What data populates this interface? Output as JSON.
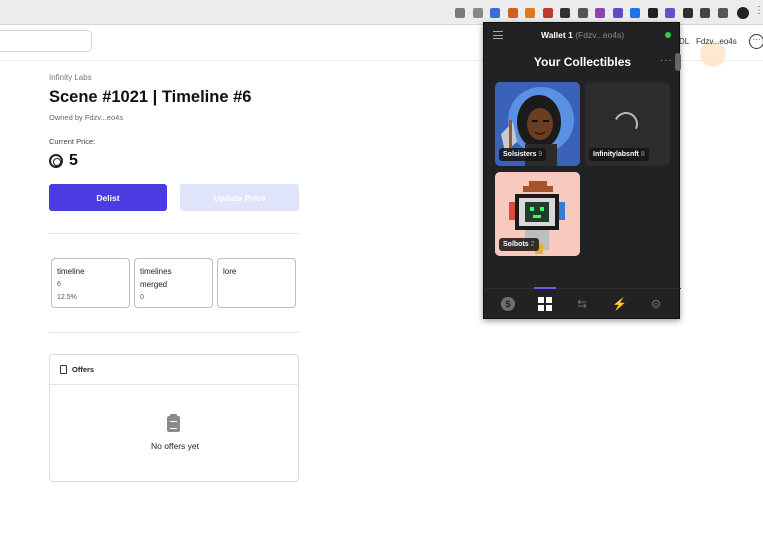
{
  "browser": {
    "extension_colors": [
      "#7a7a7a",
      "#888888",
      "#3b6fd8",
      "#d45d1b",
      "#e4761b",
      "#c0392b",
      "#333333",
      "#555555",
      "#8e44ad",
      "#5f4ccd",
      "#1a73e8",
      "#222222",
      "#6650c8",
      "#2f2f2f",
      "#444444",
      "#555555"
    ]
  },
  "header": {
    "user_suffix": "DL",
    "user_address": "Fdzv...eo4s",
    "more_label": "···"
  },
  "nft": {
    "collection": "Infinity Labs",
    "title": "Scene #1021 | Timeline #6",
    "owned_by": "Owned by Fdzv...eo4s",
    "current_price_label": "Current Price:",
    "price": "5",
    "delist_label": "Delist",
    "update_price_label": "Update Price",
    "attributes": [
      {
        "key": "timeline",
        "value": "6",
        "rarity": "12.5%"
      },
      {
        "key": "timelines merged",
        "value": "0",
        "rarity": ""
      },
      {
        "key": "lore",
        "value": "",
        "rarity": ""
      }
    ]
  },
  "offers": {
    "title": "Offers",
    "empty_text": "No offers yet"
  },
  "wallet": {
    "name": "Wallet 1",
    "address": "(Fdzv...eo4s)",
    "heading": "Your Collectibles",
    "more_label": "···",
    "collectibles": [
      {
        "name": "Solsisters",
        "count": "9"
      },
      {
        "name": "Infinitylabsnft",
        "count": "8"
      },
      {
        "name": "Solbots",
        "count": "2"
      }
    ],
    "nav": [
      "dollar-icon",
      "collectibles-grid-icon",
      "swap-arrows-icon",
      "lightning-icon",
      "settings-gear-icon"
    ],
    "colors": {
      "background": "#222224",
      "accent": "#6a5af0",
      "online": "#2ecc40"
    }
  },
  "colors": {
    "primary_button": "#4a3be2",
    "disabled_button": "#dfe4fb"
  }
}
